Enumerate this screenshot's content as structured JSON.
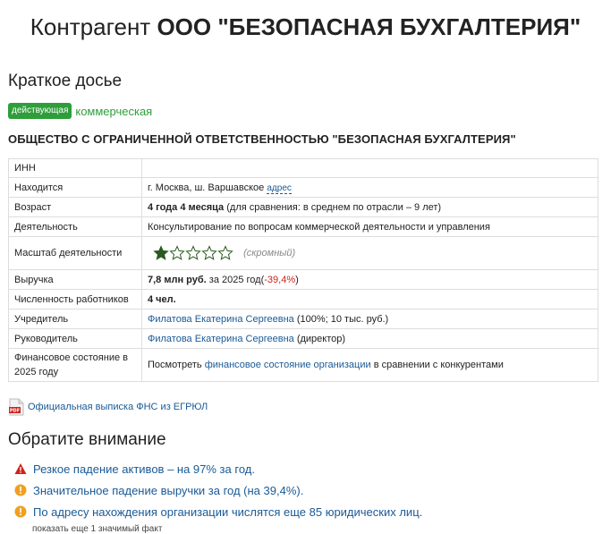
{
  "header": {
    "prefix": "Контрагент",
    "company_short": "ООО \"БЕЗОПАСНАЯ БУХГАЛТЕРИЯ\""
  },
  "dossier": {
    "heading": "Краткое досье",
    "status_badge": "действующая",
    "type": "коммерческая",
    "full_name": "ОБЩЕСТВО С ОГРАНИЧЕННОЙ ОТВЕТСТВЕННОСТЬЮ \"БЕЗОПАСНАЯ БУХГАЛТЕРИЯ\""
  },
  "table": {
    "inn_label": "ИНН",
    "inn_value": "",
    "location_label": "Находится",
    "location_value": "г. Москва, ш. Варшавское",
    "location_link": "адрес",
    "age_label": "Возраст",
    "age_value": "4 года 4 месяца",
    "age_note": "(для сравнения: в среднем по отрасли – 9 лет)",
    "activity_label": "Деятельность",
    "activity_value": "Консультирование по вопросам коммерческой деятельности и управления",
    "scale_label": "Масштаб деятельности",
    "scale_rating": 1,
    "scale_max": 5,
    "scale_note": "(скромный)",
    "revenue_label": "Выручка",
    "revenue_value": "7,8 млн руб.",
    "revenue_period": "за 2025 год",
    "revenue_change_open": "(",
    "revenue_change": "-39,4%",
    "revenue_change_close": ")",
    "employees_label": "Численность работников",
    "employees_value": "4 чел.",
    "founder_label": "Учредитель",
    "founder_name": "Филатова Екатерина Сергеевна",
    "founder_note": "(100%; 10 тыс. руб.)",
    "director_label": "Руководитель",
    "director_name": "Филатова Екатерина Сергеевна",
    "director_note": "(директор)",
    "finance_label": "Финансовое состояние в 2025 году",
    "finance_prefix": "Посмотреть",
    "finance_link": "финансовое состояние организации",
    "finance_suffix": "в сравнении с конкурентами"
  },
  "egrul": {
    "icon": "pdf-icon",
    "label": "Официальная выписка ФНС из ЕГРЮЛ"
  },
  "attention": {
    "heading": "Обратите внимание",
    "items": [
      {
        "icon": "warning-triangle-icon",
        "text": "Резкое падение активов – на 97% за год.",
        "color": "#d0221b"
      },
      {
        "icon": "exclamation-circle-icon",
        "text": "Значительное падение выручки за год (на 39,4%).",
        "color": "#f0a020"
      },
      {
        "icon": "exclamation-circle-icon",
        "text": "По адресу нахождения организации числятся еще 85 юридических лиц.",
        "color": "#f0a020"
      }
    ],
    "cutoff_text": "показать еще 1 значимый факт"
  }
}
